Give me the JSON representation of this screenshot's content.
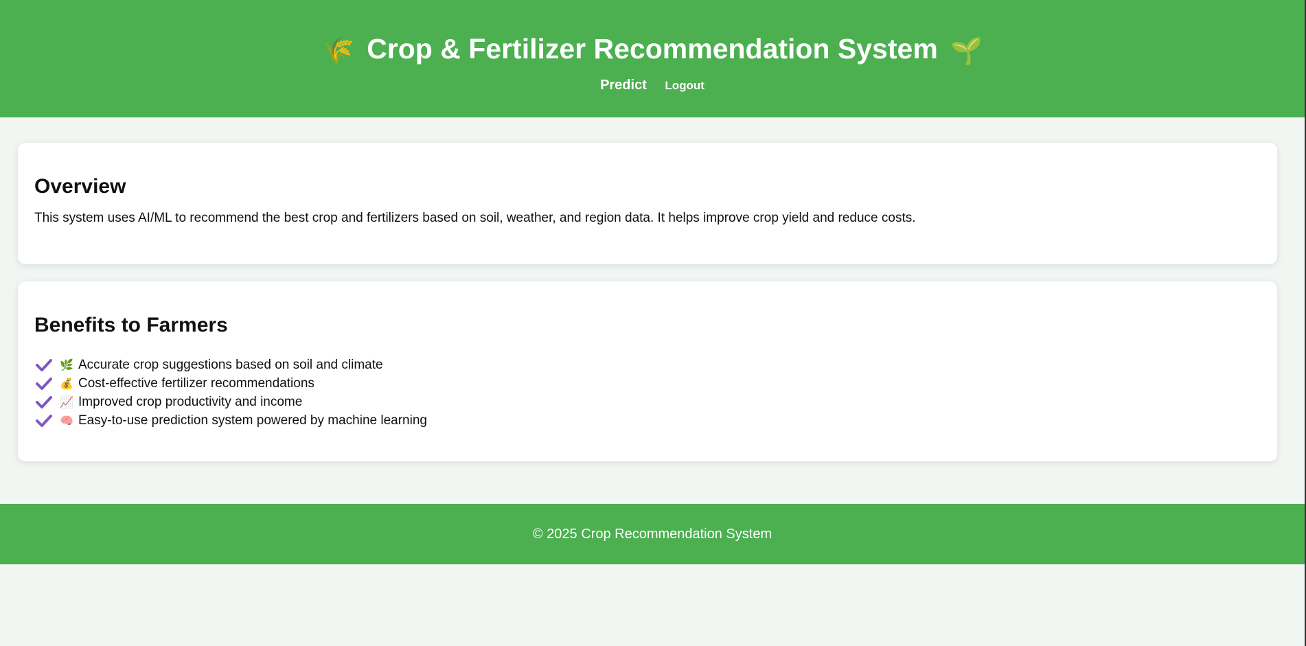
{
  "header": {
    "title": "Crop & Fertilizer Recommendation System",
    "left_emoji": "🌾",
    "right_emoji": "🌱",
    "nav": {
      "predict": "Predict",
      "logout": "Logout"
    }
  },
  "overview": {
    "heading": "Overview",
    "text": "This system uses AI/ML to recommend the best crop and fertilizers based on soil, weather, and region data. It helps improve crop yield and reduce costs."
  },
  "benefits": {
    "heading": "Benefits to Farmers",
    "items": [
      {
        "icon": "🌿",
        "icon_name": "herb-icon",
        "text": "Accurate crop suggestions based on soil and climate"
      },
      {
        "icon": "💰",
        "icon_name": "money-bag-icon",
        "text": "Cost-effective fertilizer recommendations"
      },
      {
        "icon": "📈",
        "icon_name": "chart-increasing-icon",
        "text": "Improved crop productivity and income"
      },
      {
        "icon": "🧠",
        "icon_name": "brain-icon",
        "text": "Easy-to-use prediction system powered by machine learning"
      }
    ]
  },
  "footer": {
    "text": "© 2025 Crop Recommendation System"
  },
  "colors": {
    "brand_green": "#4caf50",
    "background": "#f2f6f2",
    "check_purple": "#7e57c2"
  }
}
